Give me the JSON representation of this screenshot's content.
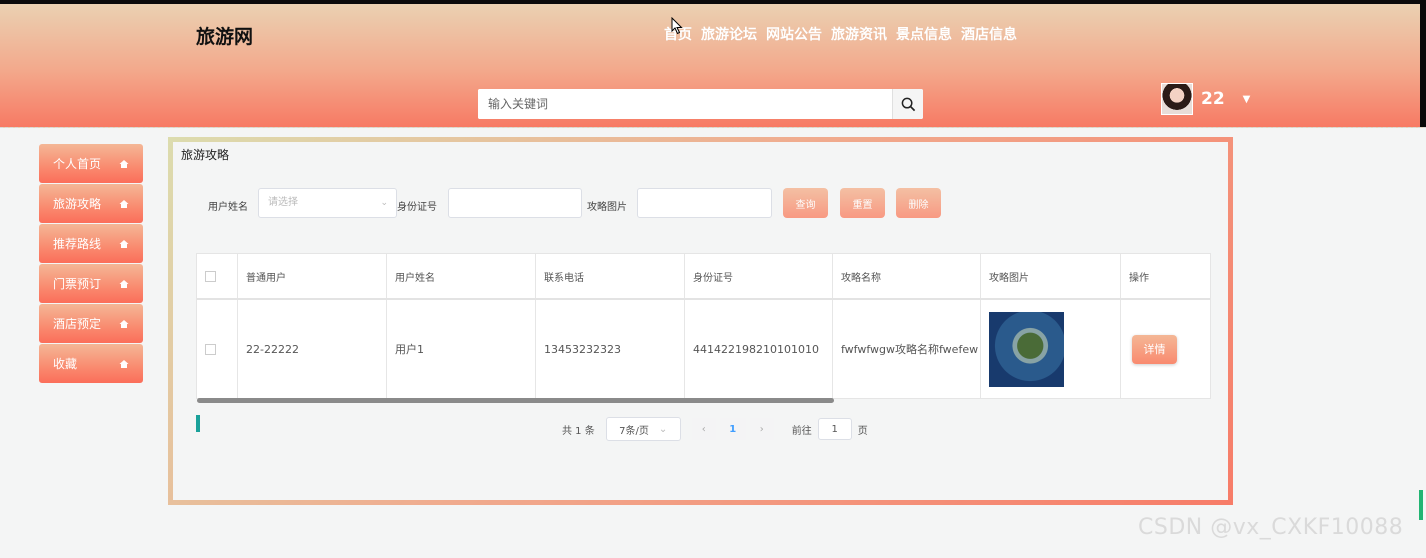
{
  "header": {
    "logo": "旅游网",
    "nav": [
      "首页",
      "旅游论坛",
      "网站公告",
      "旅游资讯",
      "景点信息",
      "酒店信息"
    ],
    "search_placeholder": "输入关键词",
    "username": "22"
  },
  "sidebar": {
    "items": [
      "个人首页",
      "旅游攻略",
      "推荐路线",
      "门票预订",
      "酒店预定",
      "收藏"
    ]
  },
  "main": {
    "title": "旅游攻略",
    "filters": {
      "name_label": "用户姓名",
      "name_placeholder": "请选择",
      "id_label": "身份证号",
      "image_label": "攻略图片",
      "query": "查询",
      "reset": "重置",
      "delete": "删除"
    },
    "table": {
      "columns": [
        "普通用户",
        "用户姓名",
        "联系电话",
        "身份证号",
        "攻略名称",
        "攻略图片",
        "操作"
      ],
      "rows": [
        [
          "22-22222",
          "用户1",
          "13453232323",
          "441422198210101010",
          "fwfwfwgw攻略名称fwefew",
          "",
          "详情"
        ]
      ]
    },
    "pagination": {
      "total": "共 1 条",
      "page_size": "7条/页",
      "current": "1",
      "goto_label": "前往",
      "goto_value": "1",
      "page_suffix": "页"
    }
  },
  "watermark": "CSDN @vx_CXKF10088",
  "colors": {
    "accent": "#f98a6f",
    "header_top": "#ead3b4",
    "header_bottom": "#f77a64"
  }
}
